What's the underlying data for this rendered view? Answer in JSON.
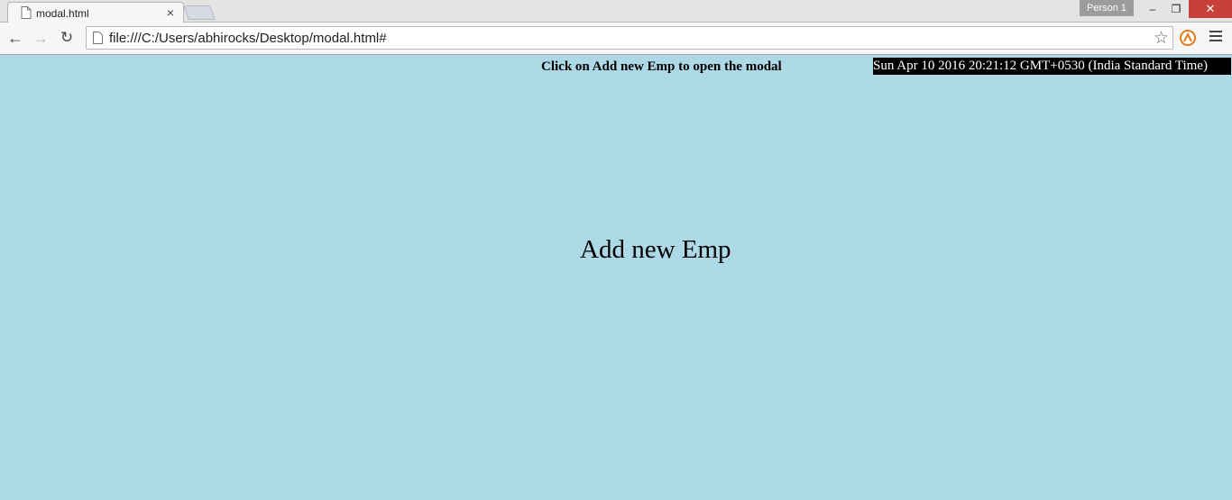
{
  "browser": {
    "tab_title": "modal.html",
    "tab_close": "×",
    "profile_label": "Person 1",
    "window_buttons": {
      "minimize": "‒",
      "maximize": "❐",
      "close": "✕"
    },
    "url": "file:///C:/Users/abhirocks/Desktop/modal.html#",
    "nav": {
      "back": "←",
      "forward": "→",
      "reload": "↻"
    },
    "star": "☆"
  },
  "page": {
    "background_color": "#add8e6",
    "hint_text": "Click on Add new Emp to open the modal",
    "clock_text": "Sun Apr 10 2016 20:21:12 GMT+0530 (India Standard Time)",
    "add_link_text": "Add new Emp"
  },
  "icons": {
    "tab": "document-icon",
    "omnibox": "page-icon",
    "bookmark": "star-icon",
    "extension": "extension-icon",
    "menu": "hamburger-menu-icon"
  }
}
